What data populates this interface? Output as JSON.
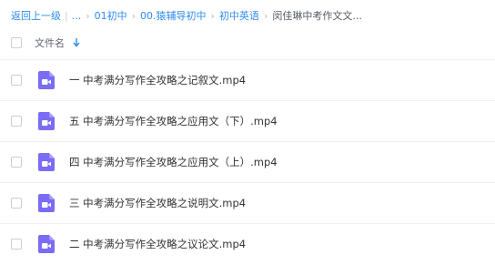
{
  "breadcrumb": {
    "back_label": "返回上一级",
    "ellipsis": "...",
    "items": [
      "01初中",
      "00.猿辅导初中",
      "初中英语"
    ],
    "current": "闵佳琳中考作文文..."
  },
  "file_list": {
    "header": {
      "name_column_label": "文件名",
      "sort_icon": "arrow-down-icon"
    },
    "file_icon": "video-file-icon",
    "accent_color": "#2f8cf0",
    "icon_color": "#7b6cf6",
    "rows": [
      {
        "name": "一 中考满分写作全攻略之记叙文.mp4"
      },
      {
        "name": "五 中考满分写作全攻略之应用文（下）.mp4"
      },
      {
        "name": "四 中考满分写作全攻略之应用文（上）.mp4"
      },
      {
        "name": "三 中考满分写作全攻略之说明文.mp4"
      },
      {
        "name": "二 中考满分写作全攻略之议论文.mp4"
      }
    ]
  }
}
